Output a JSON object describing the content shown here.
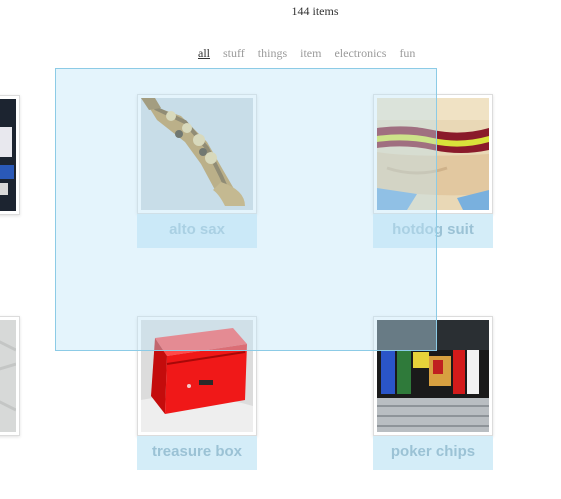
{
  "header": {
    "item_count": "144 items"
  },
  "filters": [
    {
      "label": "all",
      "active": true
    },
    {
      "label": "stuff",
      "active": false
    },
    {
      "label": "things",
      "active": false
    },
    {
      "label": "item",
      "active": false
    },
    {
      "label": "electronics",
      "active": false
    },
    {
      "label": "fun",
      "active": false
    }
  ],
  "tiles": [
    {
      "label": "alto sax",
      "image": "saxophone-photo"
    },
    {
      "label": "hotdog suit",
      "image": "hotdog-costume-photo"
    },
    {
      "label": "treasure box",
      "image": "red-box-photo"
    },
    {
      "label": "poker chips",
      "image": "poker-chip-case-photo"
    }
  ],
  "colors": {
    "selection_fill": "#bee4f8",
    "selection_border": "#8ccbe6",
    "label_band": "#d4edf8",
    "label_text": "#9bc2d5",
    "filter_inactive": "#9a9a9a",
    "filter_active": "#333333"
  }
}
